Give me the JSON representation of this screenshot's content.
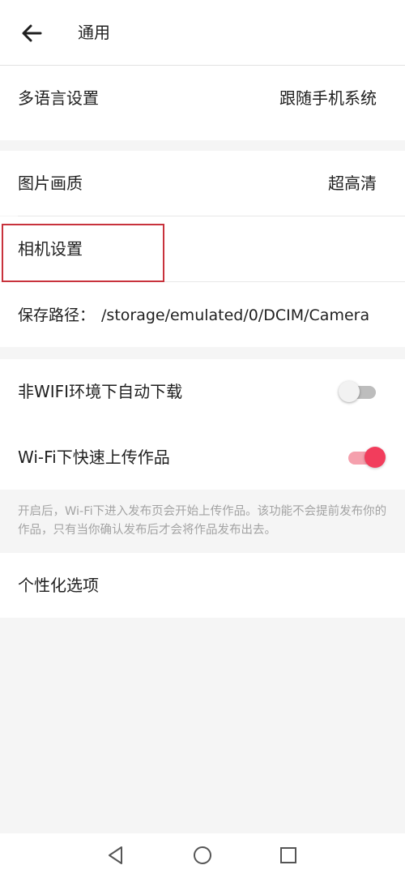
{
  "header": {
    "title": "通用",
    "back_icon": "arrow-left-icon"
  },
  "general": {
    "language": {
      "label": "多语言设置",
      "value": "跟随手机系统"
    },
    "image_quality": {
      "label": "图片画质",
      "value": "超高清"
    },
    "camera_settings": {
      "label": "相机设置"
    },
    "save_path": {
      "label": "保存路径：",
      "value": "/storage/emulated/0/DCIM/Camera"
    }
  },
  "network": {
    "auto_download": {
      "label": "非WIFI环境下自动下载",
      "enabled": false
    },
    "wifi_fast_upload": {
      "label": "Wi-Fi下快速上传作品",
      "enabled": true
    },
    "note": "开启后，Wi-Fi下进入发布页会开始上传作品。该功能不会提前发布你的作品，只有当你确认发布后才会将作品发布出去。"
  },
  "personalization": {
    "label": "个性化选项"
  },
  "navbar": {
    "icons": [
      "nav-back-icon",
      "nav-home-icon",
      "nav-recents-icon"
    ]
  },
  "colors": {
    "accent": "#f23d5c",
    "highlight_box": "#c8323c",
    "page_background": "#f5f5f5"
  }
}
